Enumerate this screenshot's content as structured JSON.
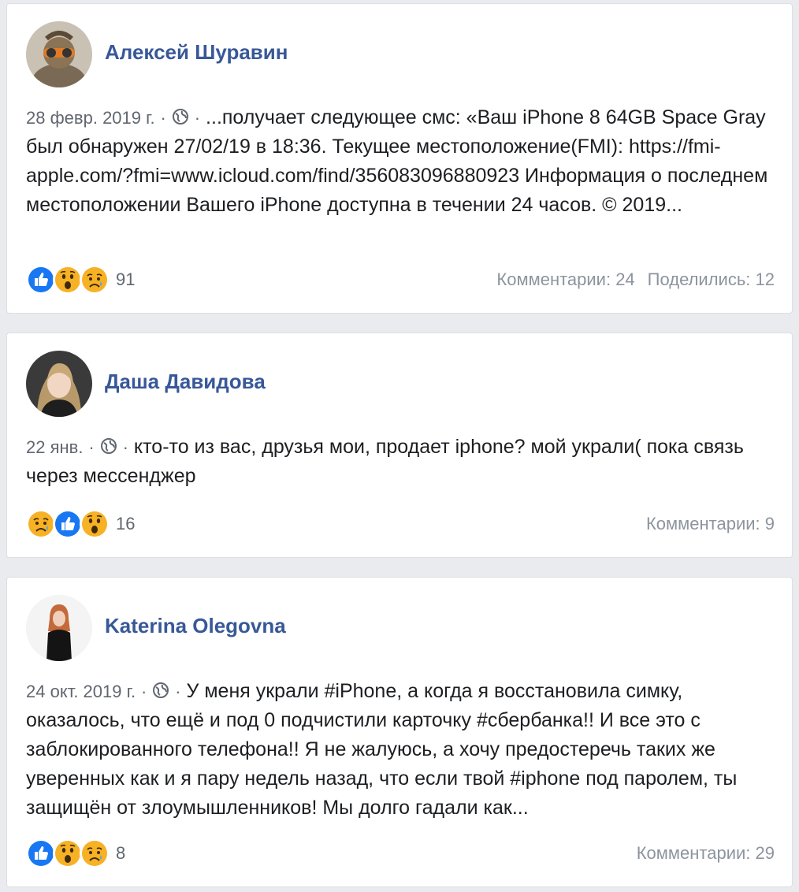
{
  "colors": {
    "author": "#385898",
    "text": "#1c1e21",
    "meta": "#616770",
    "stats": "#8d949e",
    "like": "#1877f2",
    "emoji_yellow": "#f7b125"
  },
  "posts": [
    {
      "author": "Алексей Шуравин",
      "date": "28 февр. 2019 г.",
      "separator": "·",
      "privacy_icon": "globe-icon",
      "text": "...получает следующее смс: «Ваш iPhone 8 64GB Space Gray был обнаружен 27/02/19 в 18:36. Текущее местоположение(FMI): https://fmi-apple.com/?fmi=www.icloud.com/find/356083096880923 Информация о последнем местоположении Вашего iPhone доступна в течении 24 часов. © 2019...",
      "reactions": [
        "like-icon",
        "wow-icon",
        "sad-icon"
      ],
      "reaction_count": "91",
      "comments": "Комментарии: 24",
      "shares": "Поделились: 12"
    },
    {
      "author": "Даша Давидова",
      "date": "22 янв.",
      "separator": "·",
      "privacy_icon": "globe-icon",
      "text": "кто-то из вас, друзья мои, продает iphone? мой украли( пока связь через мессенджер",
      "reactions": [
        "sad-icon",
        "like-icon",
        "wow-icon"
      ],
      "reaction_count": "16",
      "comments": "Комментарии: 9"
    },
    {
      "author": "Katerina Olegovna",
      "date": "24 окт. 2019 г.",
      "separator": "·",
      "privacy_icon": "globe-icon",
      "text": "У меня украли #iPhone, а когда я восстановила симку, оказалось, что ещё и под 0 подчистили карточку #сбербанка!! И все это с заблокированного телефона!! Я не жалуюсь, а хочу предостеречь таких же уверенных как и я пару недель назад, что если твой #iphone под паролем, ты защищён от злоумышленников! Мы долго гадали как...",
      "reactions": [
        "like-icon",
        "wow-icon",
        "sad-icon"
      ],
      "reaction_count": "8",
      "comments": "Комментарии: 29"
    }
  ]
}
